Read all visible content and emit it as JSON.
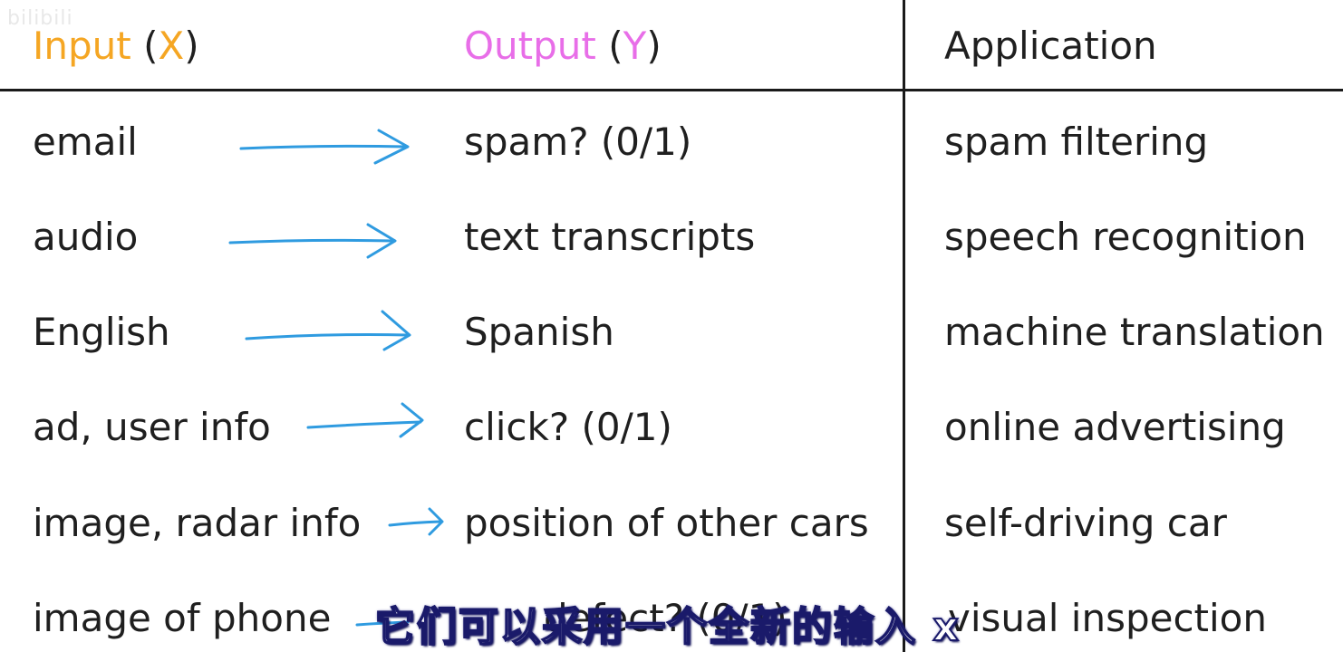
{
  "watermark": "bilibili",
  "header": {
    "input_word": "Input",
    "input_var": "X",
    "output_word": "Output",
    "output_var": "Y",
    "application": "Application",
    "paren_open": "(",
    "paren_close": ")"
  },
  "colors": {
    "input_accent": "#f5a623",
    "output_accent": "#e86ee8",
    "arrow": "#2f9be0",
    "rule": "#1a1a1a"
  },
  "rows": [
    {
      "input": "email",
      "output": "spam? (0/1)",
      "application": "spam filtering"
    },
    {
      "input": "audio",
      "output": "text transcripts",
      "application": "speech recognition"
    },
    {
      "input": "English",
      "output": "Spanish",
      "application": "machine translation"
    },
    {
      "input": "ad, user info",
      "output": "click? (0/1)",
      "application": "online advertising"
    },
    {
      "input": "image, radar info",
      "output": "position of other cars",
      "application": "self-driving car"
    },
    {
      "input": "image of phone",
      "output": "defect? (0/1)",
      "application": "visual inspection"
    }
  ],
  "subtitle": "它们可以采用一个全新的输入 x"
}
